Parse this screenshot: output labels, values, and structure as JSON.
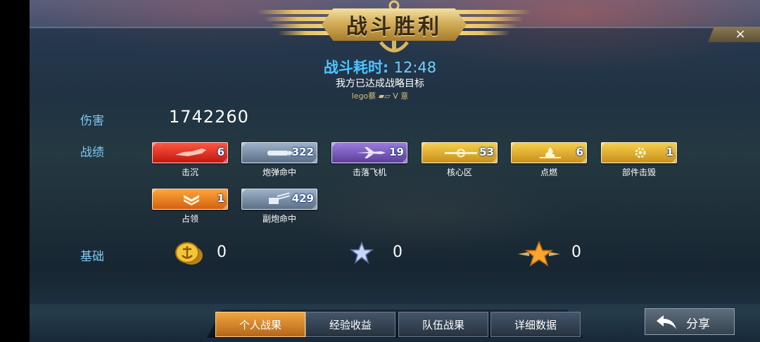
{
  "header": {
    "title": "战斗胜利",
    "close_icon": "×"
  },
  "summary": {
    "duration_label": "战斗耗时:",
    "duration_value": "12:48",
    "objective": "我方已达成战略目标",
    "player": "lego蔡 ▰▱   V   意"
  },
  "stats": {
    "damage_label": "伤害",
    "damage_value": "1742260",
    "record_label": "战绩",
    "base_label": "基础"
  },
  "medals": [
    {
      "label": "击沉",
      "count": "6",
      "color": "red",
      "icon": "ship-icon"
    },
    {
      "label": "炮弹命中",
      "count": "322",
      "color": "steel",
      "icon": "shell-icon"
    },
    {
      "label": "击落飞机",
      "count": "19",
      "color": "purple",
      "icon": "plane-icon"
    },
    {
      "label": "核心区",
      "count": "53",
      "color": "gold",
      "icon": "citadel-icon"
    },
    {
      "label": "点燃",
      "count": "6",
      "color": "gold",
      "icon": "fire-icon"
    },
    {
      "label": "部件击毁",
      "count": "1",
      "color": "gold",
      "icon": "gear-icon"
    },
    {
      "label": "占领",
      "count": "1",
      "color": "orange",
      "icon": "chevron-icon"
    },
    {
      "label": "副炮命中",
      "count": "429",
      "color": "steel",
      "icon": "secondary-gun-icon"
    }
  ],
  "base_rewards": [
    {
      "icon": "gold-coin-icon",
      "value": "0"
    },
    {
      "icon": "silver-star-icon",
      "value": "0"
    },
    {
      "icon": "gold-star-icon",
      "value": "0"
    }
  ],
  "tabs": [
    {
      "label": "个人战果",
      "active": true
    },
    {
      "label": "经验收益",
      "active": false
    },
    {
      "label": "队伍战果",
      "active": false
    },
    {
      "label": "详细数据",
      "active": false
    }
  ],
  "share": {
    "label": "分享",
    "icon": "share-arrow-icon"
  },
  "colors": {
    "accent_blue": "#4cc3ff",
    "label_blue": "#7fc9f0",
    "tab_active": "#f0a640"
  }
}
